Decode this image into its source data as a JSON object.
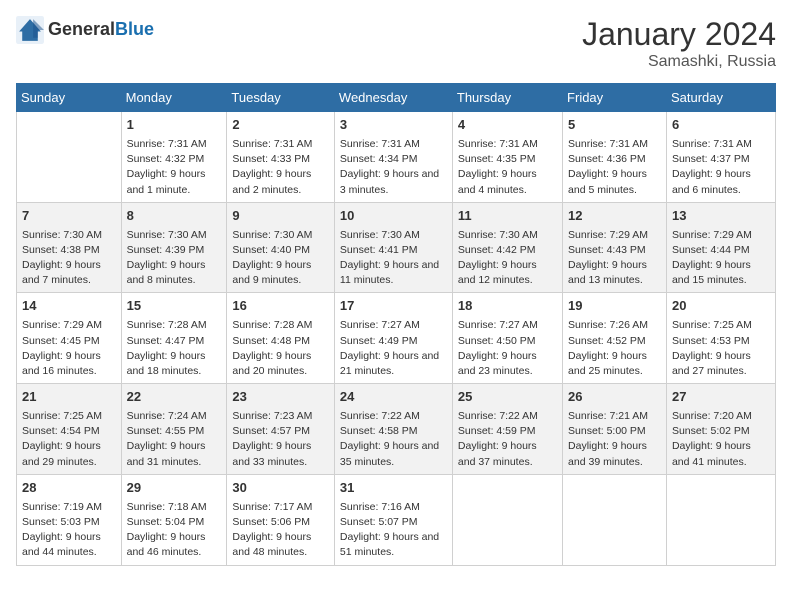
{
  "header": {
    "logo_general": "General",
    "logo_blue": "Blue",
    "month_year": "January 2024",
    "location": "Samashki, Russia"
  },
  "columns": [
    "Sunday",
    "Monday",
    "Tuesday",
    "Wednesday",
    "Thursday",
    "Friday",
    "Saturday"
  ],
  "weeks": [
    [
      {
        "day": "",
        "sunrise": "",
        "sunset": "",
        "daylight": ""
      },
      {
        "day": "1",
        "sunrise": "Sunrise: 7:31 AM",
        "sunset": "Sunset: 4:32 PM",
        "daylight": "Daylight: 9 hours and 1 minute."
      },
      {
        "day": "2",
        "sunrise": "Sunrise: 7:31 AM",
        "sunset": "Sunset: 4:33 PM",
        "daylight": "Daylight: 9 hours and 2 minutes."
      },
      {
        "day": "3",
        "sunrise": "Sunrise: 7:31 AM",
        "sunset": "Sunset: 4:34 PM",
        "daylight": "Daylight: 9 hours and 3 minutes."
      },
      {
        "day": "4",
        "sunrise": "Sunrise: 7:31 AM",
        "sunset": "Sunset: 4:35 PM",
        "daylight": "Daylight: 9 hours and 4 minutes."
      },
      {
        "day": "5",
        "sunrise": "Sunrise: 7:31 AM",
        "sunset": "Sunset: 4:36 PM",
        "daylight": "Daylight: 9 hours and 5 minutes."
      },
      {
        "day": "6",
        "sunrise": "Sunrise: 7:31 AM",
        "sunset": "Sunset: 4:37 PM",
        "daylight": "Daylight: 9 hours and 6 minutes."
      }
    ],
    [
      {
        "day": "7",
        "sunrise": "Sunrise: 7:30 AM",
        "sunset": "Sunset: 4:38 PM",
        "daylight": "Daylight: 9 hours and 7 minutes."
      },
      {
        "day": "8",
        "sunrise": "Sunrise: 7:30 AM",
        "sunset": "Sunset: 4:39 PM",
        "daylight": "Daylight: 9 hours and 8 minutes."
      },
      {
        "day": "9",
        "sunrise": "Sunrise: 7:30 AM",
        "sunset": "Sunset: 4:40 PM",
        "daylight": "Daylight: 9 hours and 9 minutes."
      },
      {
        "day": "10",
        "sunrise": "Sunrise: 7:30 AM",
        "sunset": "Sunset: 4:41 PM",
        "daylight": "Daylight: 9 hours and 11 minutes."
      },
      {
        "day": "11",
        "sunrise": "Sunrise: 7:30 AM",
        "sunset": "Sunset: 4:42 PM",
        "daylight": "Daylight: 9 hours and 12 minutes."
      },
      {
        "day": "12",
        "sunrise": "Sunrise: 7:29 AM",
        "sunset": "Sunset: 4:43 PM",
        "daylight": "Daylight: 9 hours and 13 minutes."
      },
      {
        "day": "13",
        "sunrise": "Sunrise: 7:29 AM",
        "sunset": "Sunset: 4:44 PM",
        "daylight": "Daylight: 9 hours and 15 minutes."
      }
    ],
    [
      {
        "day": "14",
        "sunrise": "Sunrise: 7:29 AM",
        "sunset": "Sunset: 4:45 PM",
        "daylight": "Daylight: 9 hours and 16 minutes."
      },
      {
        "day": "15",
        "sunrise": "Sunrise: 7:28 AM",
        "sunset": "Sunset: 4:47 PM",
        "daylight": "Daylight: 9 hours and 18 minutes."
      },
      {
        "day": "16",
        "sunrise": "Sunrise: 7:28 AM",
        "sunset": "Sunset: 4:48 PM",
        "daylight": "Daylight: 9 hours and 20 minutes."
      },
      {
        "day": "17",
        "sunrise": "Sunrise: 7:27 AM",
        "sunset": "Sunset: 4:49 PM",
        "daylight": "Daylight: 9 hours and 21 minutes."
      },
      {
        "day": "18",
        "sunrise": "Sunrise: 7:27 AM",
        "sunset": "Sunset: 4:50 PM",
        "daylight": "Daylight: 9 hours and 23 minutes."
      },
      {
        "day": "19",
        "sunrise": "Sunrise: 7:26 AM",
        "sunset": "Sunset: 4:52 PM",
        "daylight": "Daylight: 9 hours and 25 minutes."
      },
      {
        "day": "20",
        "sunrise": "Sunrise: 7:25 AM",
        "sunset": "Sunset: 4:53 PM",
        "daylight": "Daylight: 9 hours and 27 minutes."
      }
    ],
    [
      {
        "day": "21",
        "sunrise": "Sunrise: 7:25 AM",
        "sunset": "Sunset: 4:54 PM",
        "daylight": "Daylight: 9 hours and 29 minutes."
      },
      {
        "day": "22",
        "sunrise": "Sunrise: 7:24 AM",
        "sunset": "Sunset: 4:55 PM",
        "daylight": "Daylight: 9 hours and 31 minutes."
      },
      {
        "day": "23",
        "sunrise": "Sunrise: 7:23 AM",
        "sunset": "Sunset: 4:57 PM",
        "daylight": "Daylight: 9 hours and 33 minutes."
      },
      {
        "day": "24",
        "sunrise": "Sunrise: 7:22 AM",
        "sunset": "Sunset: 4:58 PM",
        "daylight": "Daylight: 9 hours and 35 minutes."
      },
      {
        "day": "25",
        "sunrise": "Sunrise: 7:22 AM",
        "sunset": "Sunset: 4:59 PM",
        "daylight": "Daylight: 9 hours and 37 minutes."
      },
      {
        "day": "26",
        "sunrise": "Sunrise: 7:21 AM",
        "sunset": "Sunset: 5:00 PM",
        "daylight": "Daylight: 9 hours and 39 minutes."
      },
      {
        "day": "27",
        "sunrise": "Sunrise: 7:20 AM",
        "sunset": "Sunset: 5:02 PM",
        "daylight": "Daylight: 9 hours and 41 minutes."
      }
    ],
    [
      {
        "day": "28",
        "sunrise": "Sunrise: 7:19 AM",
        "sunset": "Sunset: 5:03 PM",
        "daylight": "Daylight: 9 hours and 44 minutes."
      },
      {
        "day": "29",
        "sunrise": "Sunrise: 7:18 AM",
        "sunset": "Sunset: 5:04 PM",
        "daylight": "Daylight: 9 hours and 46 minutes."
      },
      {
        "day": "30",
        "sunrise": "Sunrise: 7:17 AM",
        "sunset": "Sunset: 5:06 PM",
        "daylight": "Daylight: 9 hours and 48 minutes."
      },
      {
        "day": "31",
        "sunrise": "Sunrise: 7:16 AM",
        "sunset": "Sunset: 5:07 PM",
        "daylight": "Daylight: 9 hours and 51 minutes."
      },
      {
        "day": "",
        "sunrise": "",
        "sunset": "",
        "daylight": ""
      },
      {
        "day": "",
        "sunrise": "",
        "sunset": "",
        "daylight": ""
      },
      {
        "day": "",
        "sunrise": "",
        "sunset": "",
        "daylight": ""
      }
    ]
  ]
}
